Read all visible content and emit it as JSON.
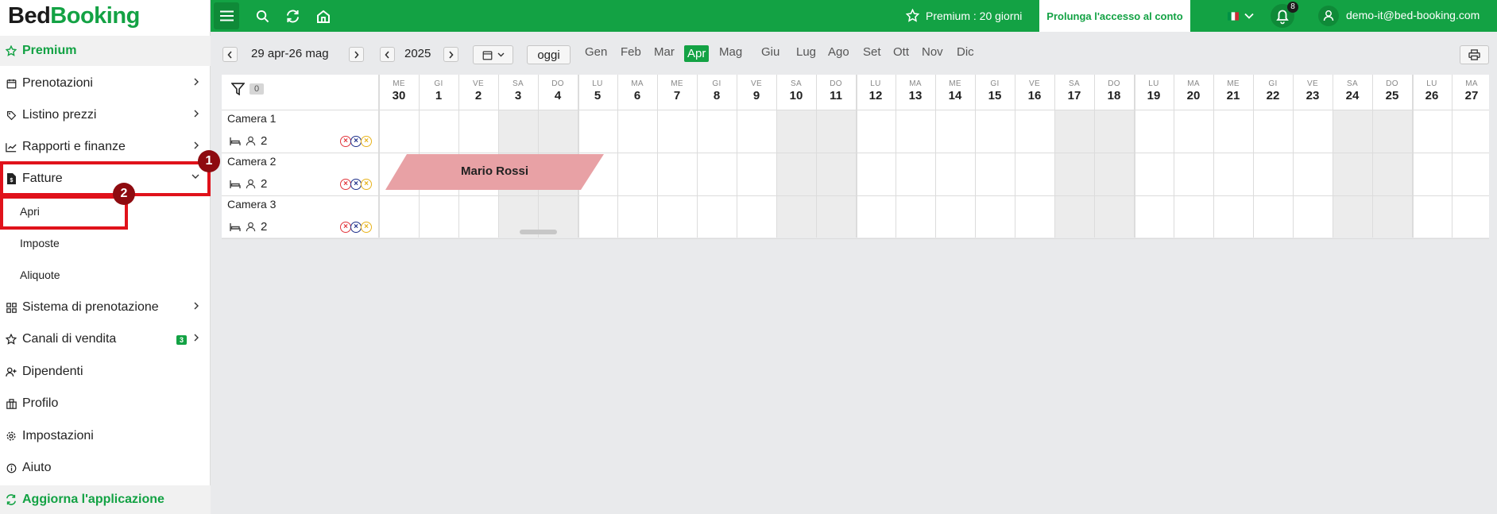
{
  "logo": {
    "part1": "Bed",
    "part2": "Booking"
  },
  "sidebar": {
    "premium": "Premium",
    "items": [
      {
        "label": "Prenotazioni",
        "icon": "calendar-icon"
      },
      {
        "label": "Listino prezzi",
        "icon": "tag-icon"
      },
      {
        "label": "Rapporti e finanze",
        "icon": "chart-icon"
      },
      {
        "label": "Fatture",
        "icon": "invoice-icon"
      }
    ],
    "subitems": [
      "Apri",
      "Imposte",
      "Aliquote"
    ],
    "items2": [
      {
        "label": "Sistema di prenotazione",
        "icon": "grid-icon"
      },
      {
        "label": "Canali di vendita",
        "icon": "star-icon",
        "badge": "3"
      },
      {
        "label": "Dipendenti",
        "icon": "user-add-icon"
      },
      {
        "label": "Profilo",
        "icon": "building-icon"
      },
      {
        "label": "Impostazioni",
        "icon": "gear-icon"
      },
      {
        "label": "Aiuto",
        "icon": "info-icon"
      }
    ],
    "update": "Aggiorna l'applicazione"
  },
  "markers": [
    "1",
    "2"
  ],
  "topbar": {
    "premium": "Premium : 20 giorni",
    "extend": "Prolunga l'accesso al conto",
    "notifications": "8",
    "email": "demo-it@bed-booking.com"
  },
  "toolbar": {
    "range": "29 apr-26 mag",
    "year": "2025",
    "today": "oggi",
    "months": [
      "Gen",
      "Feb",
      "Mar",
      "Apr",
      "Mag",
      "Giu",
      "Lug",
      "Ago",
      "Set",
      "Ott",
      "Nov",
      "Dic"
    ],
    "active_month": "Apr",
    "filter_count": "0"
  },
  "days": [
    {
      "dw": "ME",
      "dn": "30"
    },
    {
      "dw": "GI",
      "dn": "1"
    },
    {
      "dw": "VE",
      "dn": "2"
    },
    {
      "dw": "SA",
      "dn": "3"
    },
    {
      "dw": "DO",
      "dn": "4"
    },
    {
      "dw": "LU",
      "dn": "5"
    },
    {
      "dw": "MA",
      "dn": "6"
    },
    {
      "dw": "ME",
      "dn": "7"
    },
    {
      "dw": "GI",
      "dn": "8"
    },
    {
      "dw": "VE",
      "dn": "9"
    },
    {
      "dw": "SA",
      "dn": "10"
    },
    {
      "dw": "DO",
      "dn": "11"
    },
    {
      "dw": "LU",
      "dn": "12"
    },
    {
      "dw": "MA",
      "dn": "13"
    },
    {
      "dw": "ME",
      "dn": "14"
    },
    {
      "dw": "GI",
      "dn": "15"
    },
    {
      "dw": "VE",
      "dn": "16"
    },
    {
      "dw": "SA",
      "dn": "17"
    },
    {
      "dw": "DO",
      "dn": "18"
    },
    {
      "dw": "LU",
      "dn": "19"
    },
    {
      "dw": "MA",
      "dn": "20"
    },
    {
      "dw": "ME",
      "dn": "21"
    },
    {
      "dw": "GI",
      "dn": "22"
    },
    {
      "dw": "VE",
      "dn": "23"
    },
    {
      "dw": "SA",
      "dn": "24"
    },
    {
      "dw": "DO",
      "dn": "25"
    },
    {
      "dw": "LU",
      "dn": "26"
    },
    {
      "dw": "MA",
      "dn": "27"
    }
  ],
  "rooms": [
    {
      "name": "Camera 1",
      "guests": "2"
    },
    {
      "name": "Camera 2",
      "guests": "2"
    },
    {
      "name": "Camera 3",
      "guests": "2"
    }
  ],
  "booking": {
    "guest": "Mario Rossi"
  },
  "colors": {
    "accent": "#13a244",
    "booking": "#e8a1a5",
    "highlight": "#e0121b"
  }
}
